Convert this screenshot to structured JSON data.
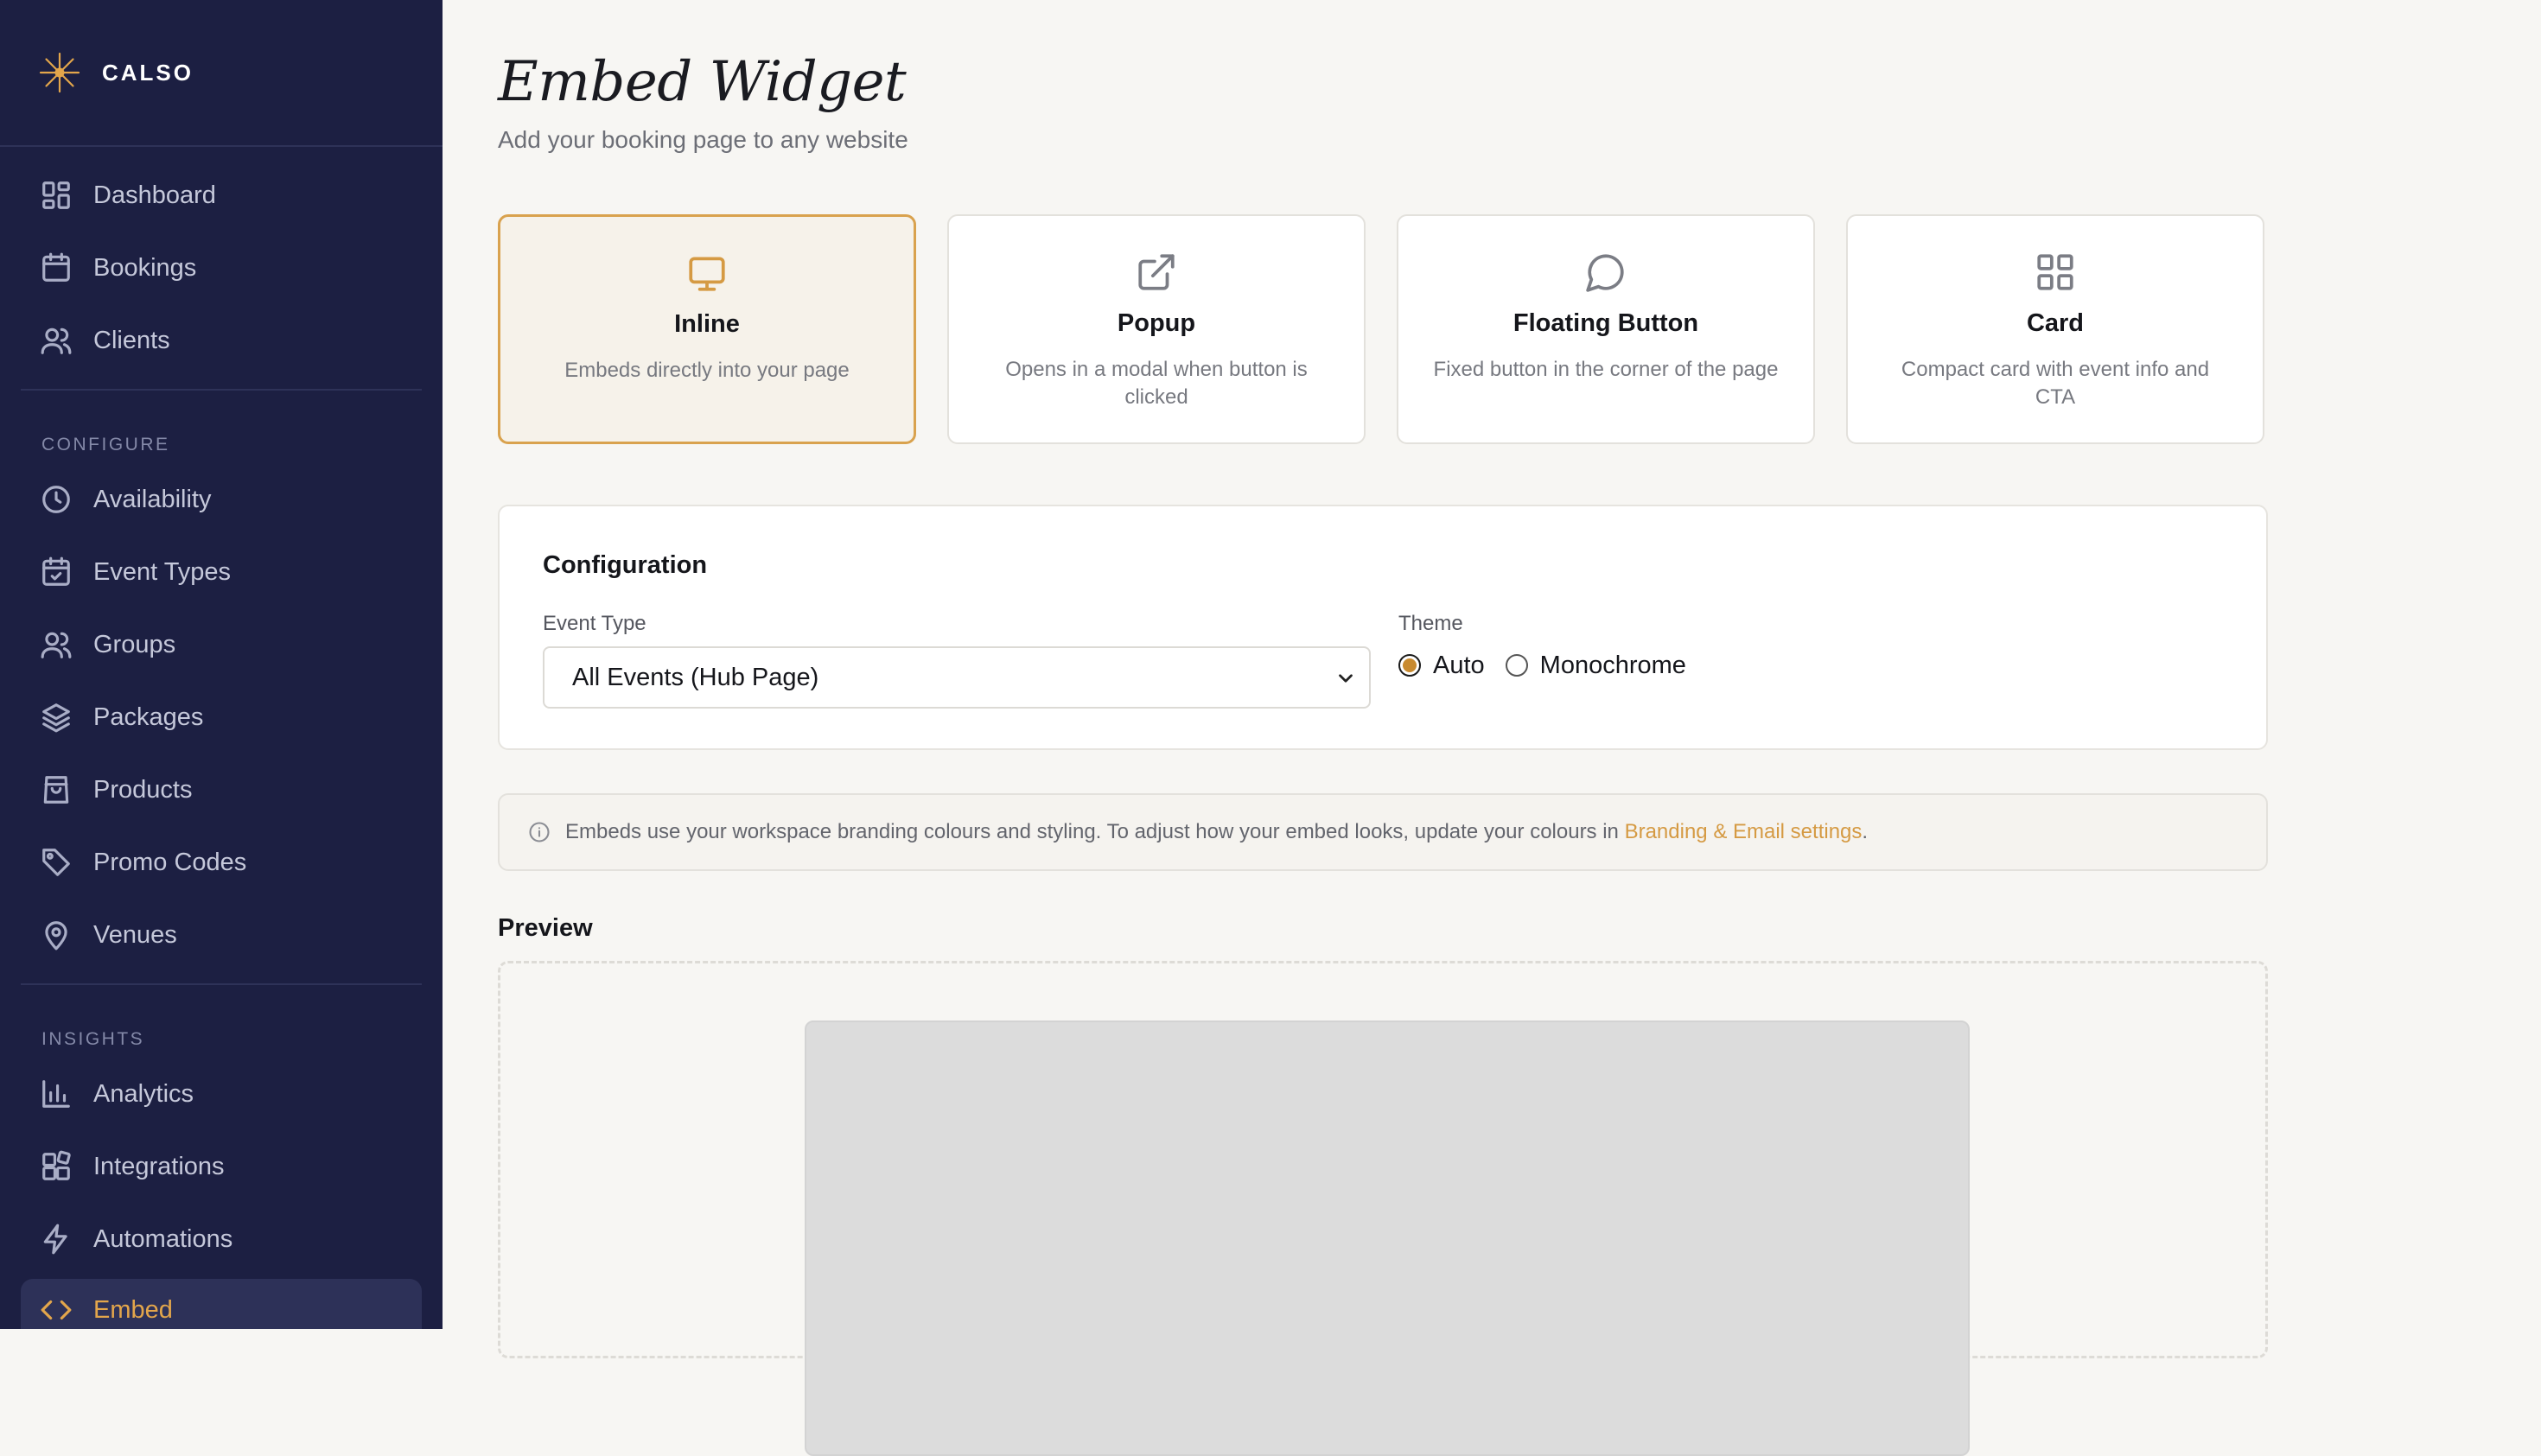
{
  "brand": {
    "name": "CALSO",
    "accent": "#e3a64b"
  },
  "sidebar": {
    "items_top": [
      {
        "label": "Dashboard",
        "icon": "dashboard-icon"
      },
      {
        "label": "Bookings",
        "icon": "calendar-icon"
      },
      {
        "label": "Clients",
        "icon": "users-icon"
      }
    ],
    "section_configure": "CONFIGURE",
    "items_configure": [
      {
        "label": "Availability",
        "icon": "clock-icon"
      },
      {
        "label": "Event Types",
        "icon": "calendar-check-icon"
      },
      {
        "label": "Groups",
        "icon": "group-icon"
      },
      {
        "label": "Packages",
        "icon": "layers-icon"
      },
      {
        "label": "Products",
        "icon": "shopping-bag-icon"
      },
      {
        "label": "Promo Codes",
        "icon": "tag-icon"
      },
      {
        "label": "Venues",
        "icon": "map-pin-icon"
      }
    ],
    "section_insights": "INSIGHTS",
    "items_insights": [
      {
        "label": "Analytics",
        "icon": "bar-chart-icon"
      },
      {
        "label": "Integrations",
        "icon": "puzzle-icon"
      },
      {
        "label": "Automations",
        "icon": "bolt-icon"
      },
      {
        "label": "Embed",
        "icon": "code-icon",
        "active": true
      }
    ]
  },
  "header": {
    "title": "Embed Widget",
    "subtitle": "Add your booking page to any website"
  },
  "modes": [
    {
      "title": "Inline",
      "desc": "Embeds directly into your page",
      "icon": "monitor-icon",
      "selected": true
    },
    {
      "title": "Popup",
      "desc": "Opens in a modal when button is clicked",
      "icon": "external-link-icon"
    },
    {
      "title": "Floating Button",
      "desc": "Fixed button in the corner of the page",
      "icon": "chat-bubble-icon"
    },
    {
      "title": "Card",
      "desc": "Compact card with event info and CTA",
      "icon": "grid-icon"
    }
  ],
  "config": {
    "title": "Configuration",
    "event_type_label": "Event Type",
    "event_type_value": "All Events (Hub Page)",
    "theme_label": "Theme",
    "theme_options": [
      "Auto",
      "Monochrome"
    ],
    "theme_selected": "Auto"
  },
  "info": {
    "text": "Embeds use your workspace branding colours and styling. To adjust how your embed looks, update your colours in ",
    "link": "Branding & Email settings",
    "suffix": "."
  },
  "preview": {
    "label": "Preview"
  }
}
